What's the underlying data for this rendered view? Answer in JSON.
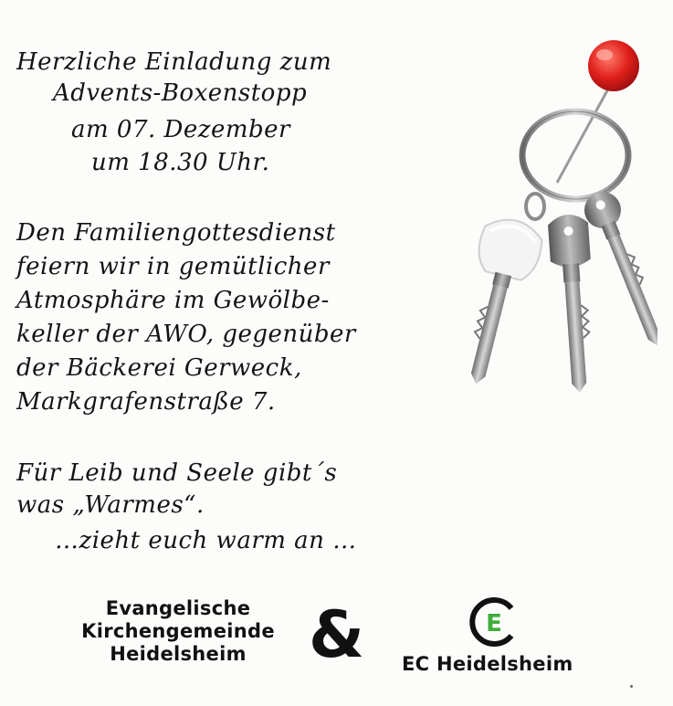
{
  "invitation": {
    "heading_lines": [
      "Herzliche Einladung zum",
      "Advents-Boxenstopp",
      "am 07. Dezember",
      "um 18.30 Uhr."
    ],
    "body_lines": [
      "Den Familiengottesdienst",
      "feiern wir in gemütlicher",
      "Atmosphäre im Gewölbe-",
      "keller der AWO, gegenüber",
      "der Bäckerei Gerweck,",
      "Markgrafenstraße 7."
    ],
    "closing_lines": [
      "Für Leib und Seele gibt´s",
      "was „Warmes“.",
      "…zieht euch warm an …"
    ]
  },
  "footer": {
    "church_lines": [
      "Evangelische",
      "Kirchengemeinde",
      "Heidelsheim"
    ],
    "ampersand": "&",
    "ec_logo_letter": "E",
    "ec_name": "EC Heidelsheim"
  },
  "illustration": {
    "icon": "keychain-with-red-pin-icon",
    "pin_color": "#e0201c",
    "metal_color": "#8c8c8c"
  }
}
